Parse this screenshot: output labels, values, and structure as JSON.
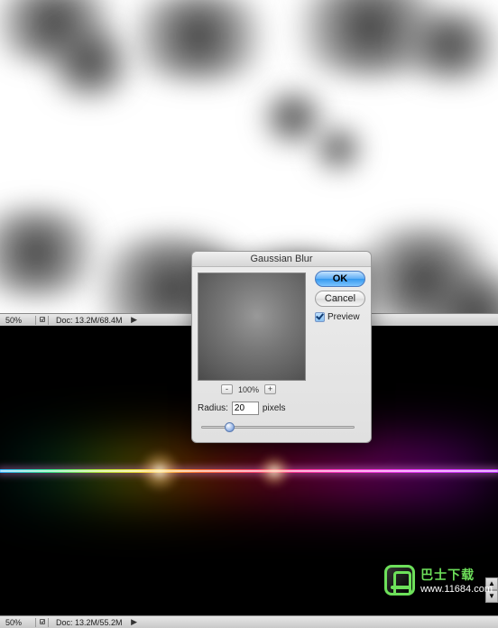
{
  "canvases": {
    "top": {
      "zoom": "50%",
      "doc_info": "Doc: 13.2M/68.4M"
    },
    "bottom": {
      "zoom": "50%",
      "doc_info": "Doc: 13.2M/55.2M"
    }
  },
  "dialog": {
    "title": "Gaussian Blur",
    "ok_label": "OK",
    "cancel_label": "Cancel",
    "preview_label": "Preview",
    "preview_checked": true,
    "preview_zoom": "100%",
    "zoom_out": "-",
    "zoom_in": "+",
    "radius_label": "Radius:",
    "radius_value": "20",
    "radius_unit": "pixels"
  },
  "watermark": {
    "title": "巴士下载",
    "url": "www.11684.com"
  },
  "icons": {
    "nav_arrow": "▶",
    "arrow_up": "▲",
    "arrow_down": "▼"
  }
}
